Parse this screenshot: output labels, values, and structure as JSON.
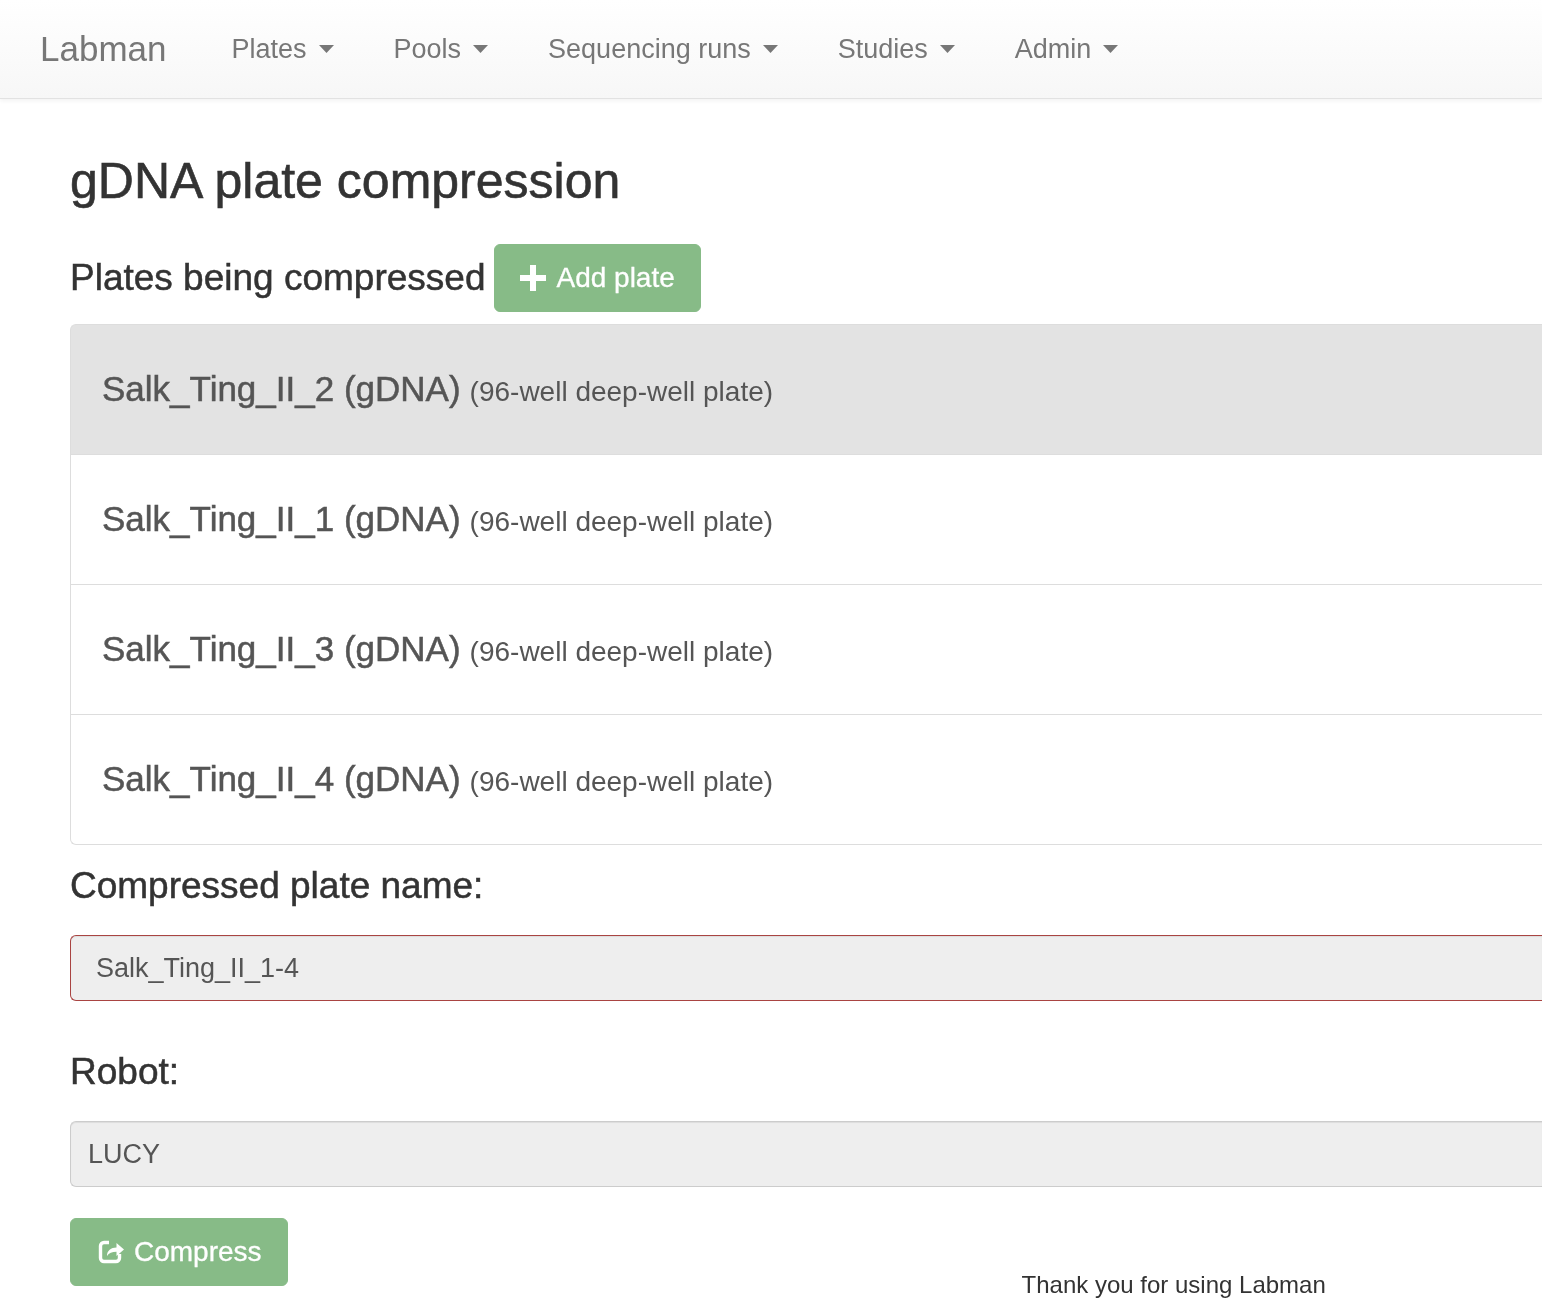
{
  "navbar": {
    "brand": "Labman",
    "menus": [
      {
        "label": "Plates"
      },
      {
        "label": "Pools"
      },
      {
        "label": "Sequencing runs"
      },
      {
        "label": "Studies"
      },
      {
        "label": "Admin"
      }
    ]
  },
  "page": {
    "title": "gDNA plate compression"
  },
  "plates_section": {
    "heading": "Plates being compressed",
    "add_button": {
      "label": "Add plate",
      "disabled": true
    },
    "plates": [
      {
        "name": "Salk_Ting_II_2 (gDNA)",
        "type": "(96-well deep-well plate)",
        "selected": true
      },
      {
        "name": "Salk_Ting_II_1 (gDNA)",
        "type": "(96-well deep-well plate)",
        "selected": false
      },
      {
        "name": "Salk_Ting_II_3 (gDNA)",
        "type": "(96-well deep-well plate)",
        "selected": false
      },
      {
        "name": "Salk_Ting_II_4 (gDNA)",
        "type": "(96-well deep-well plate)",
        "selected": false
      }
    ]
  },
  "plate_name_field": {
    "label": "Compressed plate name:",
    "value": "Salk_Ting_II_1-4",
    "invalid": true,
    "disabled": true
  },
  "robot_field": {
    "label": "Robot:",
    "value": "LUCY",
    "disabled": true
  },
  "compress_button": {
    "label": "Compress",
    "disabled": true
  },
  "footer": {
    "text": "Thank you for using Labman"
  }
}
